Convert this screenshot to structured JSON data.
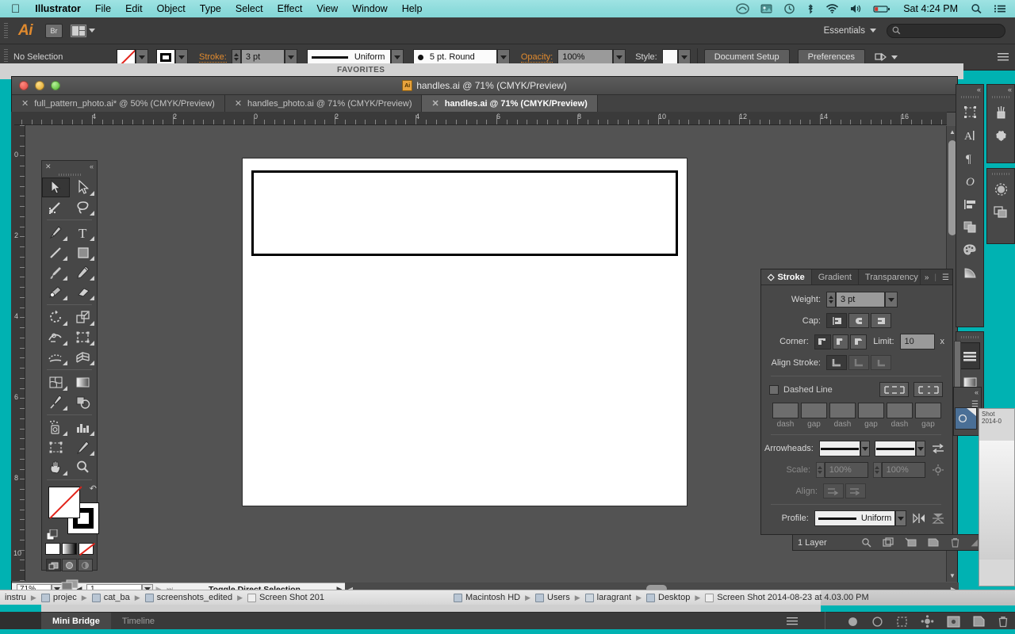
{
  "menubar": {
    "apple": "apple-logo",
    "app_name": "Illustrator",
    "items": [
      "File",
      "Edit",
      "Object",
      "Type",
      "Select",
      "Effect",
      "View",
      "Window",
      "Help"
    ],
    "status_icons": [
      "creative-cloud-icon",
      "dropbox-icon",
      "time-machine-icon",
      "bluetooth-icon",
      "wifi-icon",
      "volume-icon",
      "battery-icon"
    ],
    "clock": "Sat 4:24 PM",
    "search_icon": "search-icon",
    "notification_icon": "notification-center-icon"
  },
  "app_bar": {
    "logo": "Ai",
    "bridge_button": "Br",
    "arrange_icon": "arrange-documents-icon",
    "workspace": "Essentials",
    "search_placeholder": ""
  },
  "control_bar": {
    "selection_status": "No Selection",
    "fill_label": "fill-swatch",
    "stroke_swatch_label": "stroke-swatch",
    "stroke_label": "Stroke:",
    "stroke_weight": "3 pt",
    "profile_value": "Uniform",
    "brush_value": "5 pt. Round",
    "opacity_label": "Opacity:",
    "opacity_value": "100%",
    "style_label": "Style:",
    "document_setup": "Document Setup",
    "preferences": "Preferences"
  },
  "document_window": {
    "title": "handles.ai @ 71% (CMYK/Preview)",
    "tabs": [
      {
        "label": "full_pattern_photo.ai* @ 50% (CMYK/Preview)",
        "active": false
      },
      {
        "label": "handles_photo.ai @ 71% (CMYK/Preview)",
        "active": false
      },
      {
        "label": "handles.ai @ 71% (CMYK/Preview)",
        "active": true
      }
    ],
    "ruler_h_ticks": [
      "4",
      "2",
      "0",
      "2",
      "4",
      "6",
      "8",
      "10",
      "12",
      "14",
      "16"
    ],
    "ruler_v_ticks": [
      "0",
      "2",
      "4",
      "6",
      "8",
      "10"
    ]
  },
  "status_bar": {
    "zoom": "71%",
    "page": "1",
    "tool_status": "Toggle Direct Selection"
  },
  "toolbox": {
    "tools": [
      "selection-tool",
      "direct-selection-tool",
      "magic-wand-tool",
      "lasso-tool",
      "pen-tool",
      "type-tool",
      "line-segment-tool",
      "rectangle-tool",
      "paintbrush-tool",
      "pencil-tool",
      "blob-brush-tool",
      "eraser-tool",
      "rotate-tool",
      "scale-tool",
      "width-tool",
      "free-transform-tool",
      "shape-builder-tool",
      "perspective-grid-tool",
      "mesh-tool",
      "gradient-tool",
      "eyedropper-tool",
      "blend-tool",
      "symbol-sprayer-tool",
      "column-graph-tool",
      "artboard-tool",
      "slice-tool",
      "hand-tool",
      "zoom-tool"
    ],
    "fill_mode": "none-fill",
    "stroke_mode": "black-stroke",
    "color_modes": [
      "color-swatch",
      "gradient-swatch",
      "none-swatch"
    ],
    "draw_modes": [
      "draw-normal",
      "draw-behind",
      "draw-inside"
    ],
    "screen_mode": "change-screen-mode"
  },
  "stroke_panel": {
    "tabs": [
      {
        "label": "Stroke",
        "active": true
      },
      {
        "label": "Gradient",
        "active": false
      },
      {
        "label": "Transparency",
        "active": false
      }
    ],
    "collapse_icon": "collapse-panel-icon",
    "menu_icon": "panel-menu-icon",
    "weight_label": "Weight:",
    "weight_value": "3 pt",
    "cap_label": "Cap:",
    "cap_options": [
      "butt-cap",
      "round-cap",
      "projecting-cap"
    ],
    "corner_label": "Corner:",
    "corner_options": [
      "miter-join",
      "round-join",
      "bevel-join"
    ],
    "limit_label": "Limit:",
    "limit_value": "10",
    "limit_unit": "x",
    "align_label": "Align Stroke:",
    "align_options": [
      "align-center",
      "align-inside",
      "align-outside"
    ],
    "dashed_line_label": "Dashed Line",
    "dash_preserve_icons": [
      "dash-exact-icon",
      "dash-fit-icon"
    ],
    "dash_fields": [
      "dash",
      "gap",
      "dash",
      "gap",
      "dash",
      "gap"
    ],
    "arrowheads_label": "Arrowheads:",
    "swap_icon": "swap-arrowheads-icon",
    "scale_label": "Scale:",
    "scale_start": "100%",
    "scale_end": "100%",
    "link_icon": "link-scale-icon",
    "align_arrows_label": "Align:",
    "align_arrows_options": [
      "extend-arrow-beyond-end",
      "place-arrow-at-end"
    ],
    "profile_label": "Profile:",
    "profile_value": "Uniform",
    "flip_icons": [
      "flip-across-icon",
      "flip-along-icon"
    ]
  },
  "layers_footer": {
    "label": "1 Layer",
    "icons": [
      "locate-object-icon",
      "make-clipping-mask-icon",
      "new-sublayer-icon",
      "new-layer-icon",
      "delete-selection-icon"
    ]
  },
  "right_dock": {
    "column_main": [
      "artboards-icon",
      "character-icon",
      "paragraph-icon",
      "glyphs-icon",
      "align-icon",
      "pathfinder-icon",
      "color-icon",
      "gradient-icon"
    ],
    "column_main2": [
      "stroke-panel-icon",
      "gradient-panel-icon",
      "transparency-panel-icon"
    ],
    "column_side": [
      "brushes-icon",
      "symbols-icon"
    ],
    "column_side2": [
      "appearance-icon",
      "graphic-styles-icon"
    ]
  },
  "path_bar": {
    "left_items": [
      "instru",
      "projec",
      "cat_ba",
      "screenshots_edited",
      "Screen Shot 201"
    ],
    "right_items": [
      "Macintosh HD",
      "Users",
      "laragrant",
      "Desktop",
      "Screen Shot 2014-08-23 at 4.03.00 PM"
    ]
  },
  "bottom_bar": {
    "tabs": [
      {
        "label": "Mini Bridge",
        "active": true
      },
      {
        "label": "Timeline",
        "active": false
      }
    ],
    "icons": [
      "page-menu-icon",
      "stop-icon",
      "record-icon",
      "selection-icon",
      "keyframe-icon",
      "onion-icon",
      "new-item-icon",
      "trash-icon"
    ]
  },
  "background_window": {
    "favorites_label": "FAVORITES"
  },
  "colors": {
    "menubar_tint": "#8fdcdc",
    "desktop": "#00b2b2",
    "panel_bg": "#484848",
    "chrome_bg": "#3c3c3c",
    "canvas_bg": "#535353",
    "accent_orange": "#e08a2e",
    "artboard": "#ffffff",
    "stroke_black": "#000000"
  }
}
